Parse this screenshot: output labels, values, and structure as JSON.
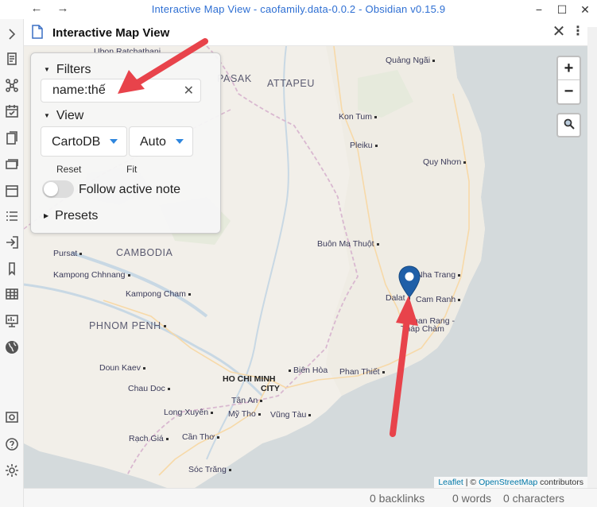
{
  "window": {
    "title": "Interactive Map View - caofamily.data-0.0.2 - Obsidian v0.15.9",
    "back": "←",
    "forward": "→",
    "minimize": "−",
    "maximize": "☐",
    "close": "✕"
  },
  "tab": {
    "title": "Interactive Map View",
    "close": "✕",
    "more": "⋮"
  },
  "panel": {
    "filters_label": "Filters",
    "filter_value": "name:thế",
    "clear": "✕",
    "view_label": "View",
    "tile_source": "CartoDB",
    "zoom_mode": "Auto",
    "reset_label": "Reset",
    "fit_label": "Fit",
    "follow_label": "Follow active note",
    "follow_active": false,
    "presets_label": "Presets"
  },
  "map": {
    "zoom_in": "+",
    "zoom_out": "−",
    "attribution_leaflet": "Leaflet",
    "attribution_sep": " | © ",
    "attribution_osm": "OpenStreetMap",
    "attribution_suffix": " contributors",
    "places": [
      {
        "name": "Ubon Ratchathani",
        "kind": "town"
      },
      {
        "name": "Quảng Ngãi",
        "kind": "town"
      },
      {
        "name": "PASAK",
        "kind": "country"
      },
      {
        "name": "ATTAPEU",
        "kind": "country"
      },
      {
        "name": "Kon Tum",
        "kind": "town"
      },
      {
        "name": "Pleiku",
        "kind": "town"
      },
      {
        "name": "Quy Nhơn",
        "kind": "town"
      },
      {
        "name": "Buôn Ma Thuột",
        "kind": "town"
      },
      {
        "name": "Pursat",
        "kind": "town"
      },
      {
        "name": "CAMBODIA",
        "kind": "country"
      },
      {
        "name": "Nha Trang",
        "kind": "town"
      },
      {
        "name": "Kampong Chhnang",
        "kind": "town"
      },
      {
        "name": "Dalat",
        "kind": "town"
      },
      {
        "name": "Cam Ranh",
        "kind": "town"
      },
      {
        "name": "Kampong Cham",
        "kind": "town"
      },
      {
        "name": "PHNOM PENH",
        "kind": "country"
      },
      {
        "name": "Phan Rang -",
        "kind": "town"
      },
      {
        "name": "Tháp Chàm",
        "kind": "town"
      },
      {
        "name": "Doun Kaev",
        "kind": "town"
      },
      {
        "name": "Biên Hòa",
        "kind": "town"
      },
      {
        "name": "Phan Thiết",
        "kind": "town"
      },
      {
        "name": "HO CHI MINH",
        "kind": "city"
      },
      {
        "name": "CITY",
        "kind": "city"
      },
      {
        "name": "Chau Doc",
        "kind": "town"
      },
      {
        "name": "Tân An",
        "kind": "town"
      },
      {
        "name": "Long Xuyên",
        "kind": "town"
      },
      {
        "name": "Mỹ Tho",
        "kind": "town"
      },
      {
        "name": "Vũng Tàu",
        "kind": "town"
      },
      {
        "name": "Rạch Giá",
        "kind": "town"
      },
      {
        "name": "Cần Thơ",
        "kind": "town"
      },
      {
        "name": "Sóc Trăng",
        "kind": "town"
      }
    ]
  },
  "status": {
    "backlinks": "0 backlinks",
    "words": "0 words",
    "characters": "0 characters"
  },
  "ribbon": [
    "chevron-right-icon",
    "files-icon",
    "graph-icon",
    "calendar-check-icon",
    "pages-icon",
    "cards-icon",
    "calendar-icon",
    "list-icon",
    "import-icon",
    "bookmark-icon",
    "table-icon",
    "slides-icon",
    "globe-icon",
    "camera-icon",
    "help-icon",
    "settings-icon"
  ]
}
